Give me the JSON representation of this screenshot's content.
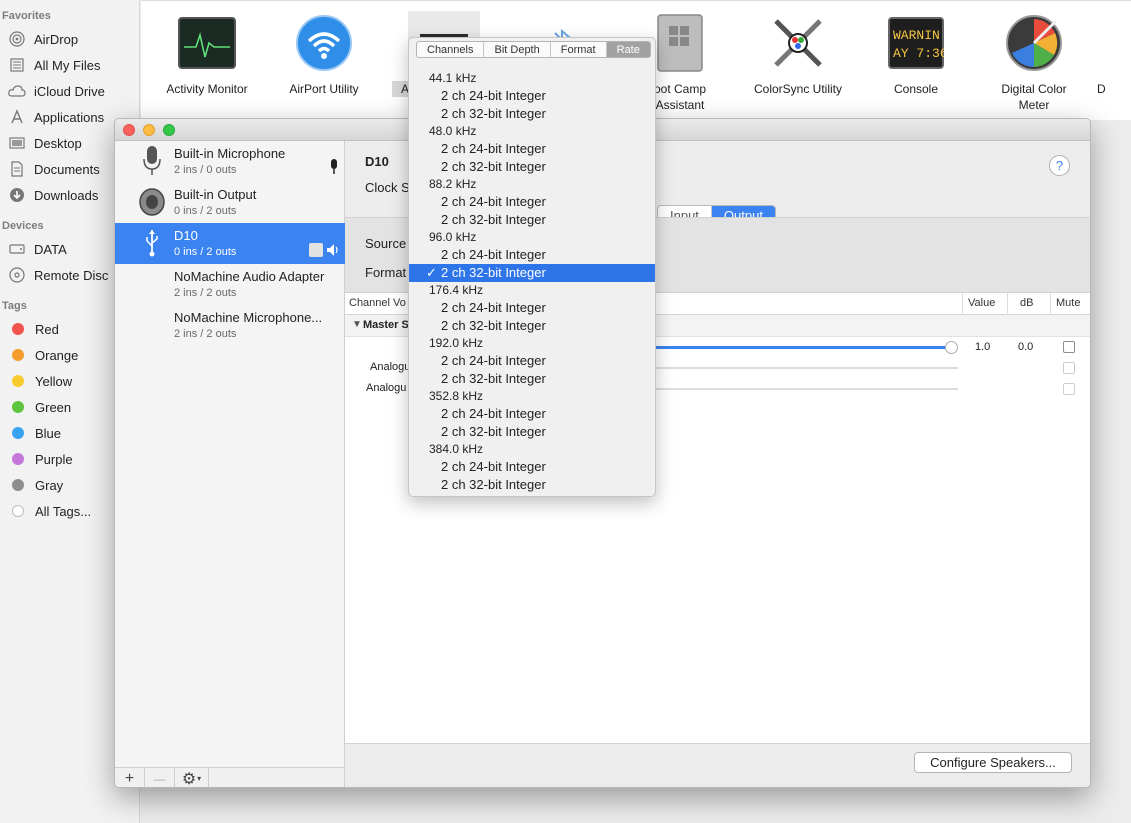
{
  "finder_sidebar": {
    "favorites_heading": "Favorites",
    "favorites": [
      {
        "label": "AirDrop",
        "icon": "airdrop-icon"
      },
      {
        "label": "All My Files",
        "icon": "all-files-icon"
      },
      {
        "label": "iCloud Drive",
        "icon": "cloud-icon"
      },
      {
        "label": "Applications",
        "icon": "applications-icon"
      },
      {
        "label": "Desktop",
        "icon": "desktop-icon"
      },
      {
        "label": "Documents",
        "icon": "documents-icon"
      },
      {
        "label": "Downloads",
        "icon": "downloads-icon"
      }
    ],
    "devices_heading": "Devices",
    "devices": [
      {
        "label": "DATA",
        "icon": "drive-icon"
      },
      {
        "label": "Remote Disc",
        "icon": "disc-icon"
      }
    ],
    "tags_heading": "Tags",
    "tags": [
      {
        "label": "Red",
        "color": "#f2544d"
      },
      {
        "label": "Orange",
        "color": "#f59d2b"
      },
      {
        "label": "Yellow",
        "color": "#f6cb2e"
      },
      {
        "label": "Green",
        "color": "#5fc53e"
      },
      {
        "label": "Blue",
        "color": "#3aa2f2"
      },
      {
        "label": "Purple",
        "color": "#c477d9"
      },
      {
        "label": "Gray",
        "color": "#8e8e8e"
      },
      {
        "label": "All Tags...",
        "color": "#d9d9d9"
      }
    ]
  },
  "apps": [
    {
      "name": "Activity Monitor"
    },
    {
      "name": "AirPort Utility"
    },
    {
      "name": "Au"
    },
    {
      "name": ""
    },
    {
      "name": "Boot Camp Assistant",
      "line1": "oot Camp",
      "line2": "Assistant"
    },
    {
      "name": "ColorSync Utility"
    },
    {
      "name": "Console",
      "screen_line1": "WARNIN",
      "screen_line2": "AY 7:36"
    },
    {
      "name": "Digital Color Meter",
      "line1": "Digital Color",
      "line2": "Meter"
    },
    {
      "name": "D"
    }
  ],
  "audio_window": {
    "devices": [
      {
        "name": "Built-in Microphone",
        "io": "2 ins / 0 outs",
        "icon": "microphone-icon"
      },
      {
        "name": "Built-in Output",
        "io": "0 ins / 2 outs",
        "icon": "speaker-icon"
      },
      {
        "name": "D10",
        "io": "0 ins / 2 outs",
        "icon": "usb-icon",
        "selected": true
      },
      {
        "name": "NoMachine Audio Adapter",
        "io": "2 ins / 2 outs"
      },
      {
        "name": "NoMachine Microphone...",
        "io": "2 ins / 2 outs"
      }
    ],
    "toolbar": {
      "add": "+",
      "remove": "—",
      "gear": "⚙"
    },
    "detail": {
      "device_title": "D10",
      "clock_label": "Clock S",
      "help": "?",
      "tab_input": "Input",
      "tab_output": "Output",
      "source_label": "Source",
      "format_label": "Format",
      "col_channel": "Channel Vo",
      "col_value": "Value",
      "col_db": "dB",
      "col_mute": "Mute",
      "master_label": "Master S",
      "master_value": "1.0",
      "master_db": "0.0",
      "master_level": 1.0,
      "analog_1": "Analogu",
      "analog_2": "Analogu",
      "configure_speakers": "Configure Speakers..."
    }
  },
  "rate_menu": {
    "tabs": [
      "Channels",
      "Bit Depth",
      "Format",
      "Rate"
    ],
    "active_tab": "Rate",
    "groups": [
      {
        "rate": "44.1 kHz",
        "options": [
          "2 ch 24-bit Integer",
          "2 ch 32-bit Integer"
        ]
      },
      {
        "rate": "48.0 kHz",
        "options": [
          "2 ch 24-bit Integer",
          "2 ch 32-bit Integer"
        ]
      },
      {
        "rate": "88.2 kHz",
        "options": [
          "2 ch 24-bit Integer",
          "2 ch 32-bit Integer"
        ]
      },
      {
        "rate": "96.0 kHz",
        "options": [
          "2 ch 24-bit Integer",
          "2 ch 32-bit Integer"
        ]
      },
      {
        "rate": "176.4 kHz",
        "options": [
          "2 ch 24-bit Integer",
          "2 ch 32-bit Integer"
        ]
      },
      {
        "rate": "192.0 kHz",
        "options": [
          "2 ch 24-bit Integer",
          "2 ch 32-bit Integer"
        ]
      },
      {
        "rate": "352.8 kHz",
        "options": [
          "2 ch 24-bit Integer",
          "2 ch 32-bit Integer"
        ]
      },
      {
        "rate": "384.0 kHz",
        "options": [
          "2 ch 24-bit Integer",
          "2 ch 32-bit Integer"
        ]
      }
    ],
    "selected": "96.0 kHz / 2 ch 32-bit Integer",
    "check_mark": "✓"
  }
}
